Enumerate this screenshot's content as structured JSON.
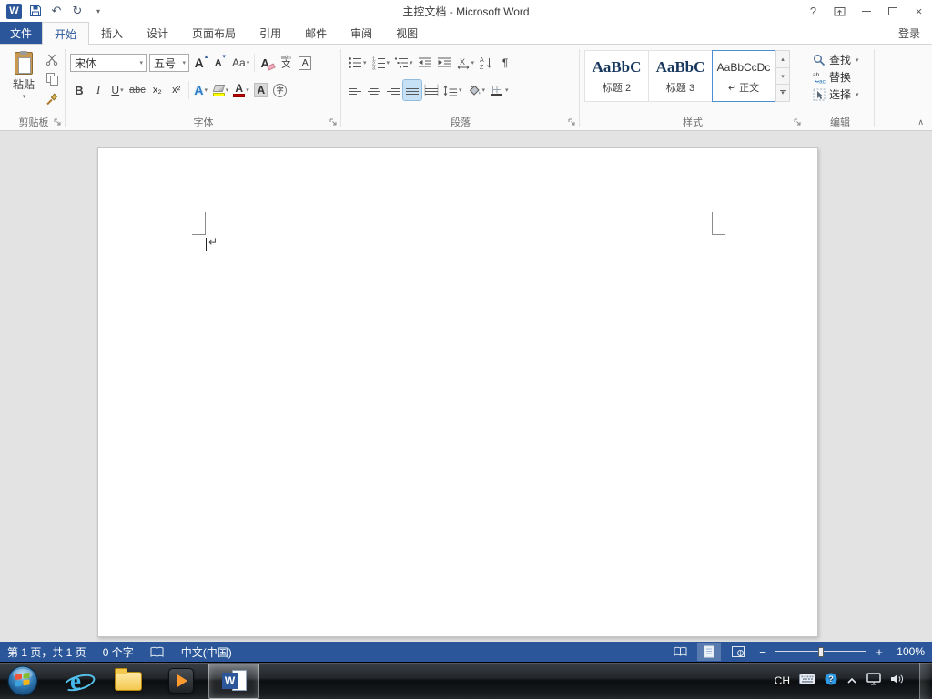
{
  "titlebar": {
    "title": "主控文档 - Microsoft Word"
  },
  "tabs": {
    "file": "文件",
    "items": [
      "开始",
      "插入",
      "设计",
      "页面布局",
      "引用",
      "邮件",
      "审阅",
      "视图"
    ],
    "signin": "登录"
  },
  "ribbon": {
    "clipboard": {
      "label": "剪贴板",
      "paste_label": "粘贴"
    },
    "font": {
      "label": "字体",
      "family": "宋体",
      "size": "五号"
    },
    "paragraph": {
      "label": "段落"
    },
    "styles": {
      "label": "样式",
      "gallery": [
        {
          "preview": "AaBbC",
          "name": "标题 2"
        },
        {
          "preview": "AaBbC",
          "name": "标题 3"
        },
        {
          "preview": "AaBbCcDc",
          "name": "↵ 正文"
        }
      ]
    },
    "editing": {
      "label": "编辑",
      "find": "查找",
      "replace": "替换",
      "select": "选择"
    }
  },
  "glyphs": {
    "undo": "↶",
    "redo": "↻",
    "down": "▾",
    "up": "▴",
    "help": "?",
    "close": "×",
    "bold": "B",
    "italic": "I",
    "underline": "U",
    "strikethrough": "abc",
    "subscript": "x₂",
    "superscript": "x²",
    "change_case": "Aa",
    "grow_font": "A",
    "shrink_font": "A",
    "clear_format": "A",
    "phonetic_top": "wén",
    "phonetic_bottom": "文",
    "char_border": "A",
    "text_effects": "A",
    "font_color": "A",
    "char_shading": "A",
    "enclose_char": "字",
    "asian_layout": "X",
    "pilcrow": "¶",
    "collapse": "∧"
  },
  "document": {
    "paragraph_mark": "↵"
  },
  "statusbar": {
    "page_info": "第 1 页，共 1 页",
    "word_count": "0 个字",
    "language": "中文(中国)",
    "zoom_out": "−",
    "zoom_in": "+",
    "zoom_level": "100%"
  },
  "taskbar": {
    "language_indicator": "CH",
    "tray_help": "?"
  }
}
